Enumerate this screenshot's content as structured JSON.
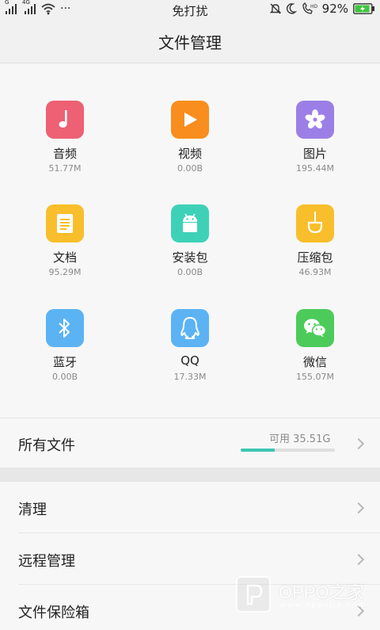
{
  "status_bar": {
    "network_label_1": "G",
    "network_label_2": "4G",
    "dots": "···",
    "center_text": "免打扰",
    "battery_percent": "92%",
    "battery_level": 0.92,
    "icons": [
      "signal-icon",
      "signal-icon",
      "wifi-icon",
      "bell-off-icon",
      "moon-icon",
      "hd-call-icon",
      "battery-charging-icon"
    ],
    "battery_color": "#3ec63e"
  },
  "header": {
    "title": "文件管理"
  },
  "categories": [
    {
      "name": "音频",
      "size": "51.77M",
      "icon": "music-note-icon",
      "color": "#ee6073"
    },
    {
      "name": "视频",
      "size": "0.00B",
      "icon": "play-icon",
      "color": "#f98d1e"
    },
    {
      "name": "图片",
      "size": "195.44M",
      "icon": "flower-icon",
      "color": "#9b7fe6"
    },
    {
      "name": "文档",
      "size": "95.29M",
      "icon": "document-icon",
      "color": "#f8be2b"
    },
    {
      "name": "安装包",
      "size": "0.00B",
      "icon": "android-icon",
      "color": "#3ed1b8"
    },
    {
      "name": "压缩包",
      "size": "46.93M",
      "icon": "archive-icon",
      "color": "#f8be2b"
    },
    {
      "name": "蓝牙",
      "size": "0.00B",
      "icon": "bluetooth-icon",
      "color": "#5bb3f4"
    },
    {
      "name": "QQ",
      "size": "17.33M",
      "icon": "qq-penguin-icon",
      "color": "#5bb3f4"
    },
    {
      "name": "微信",
      "size": "155.07M",
      "icon": "wechat-icon",
      "color": "#4ccb5a"
    }
  ],
  "all_files": {
    "label": "所有文件",
    "available": "可用 35.51G",
    "storage_used_fraction": 0.36,
    "bar_color": "#3cc6b4"
  },
  "menu": [
    {
      "label": "清理"
    },
    {
      "label": "远程管理"
    },
    {
      "label": "文件保险箱"
    }
  ],
  "watermark": {
    "text": "OPPO之家",
    "url": "www.oppojia.com"
  }
}
